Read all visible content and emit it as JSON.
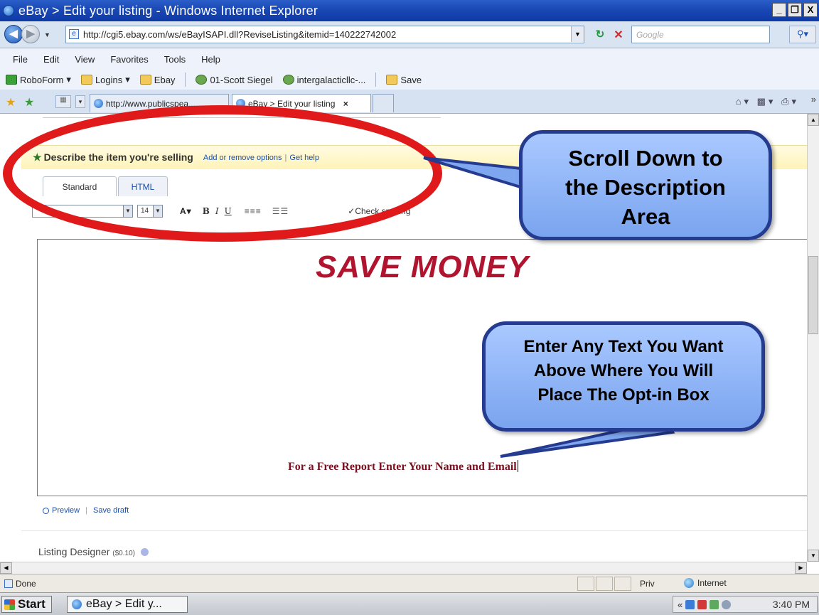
{
  "window": {
    "title": "eBay > Edit your listing - Windows Internet Explorer",
    "controls": [
      "_",
      "❐",
      "X"
    ]
  },
  "address_bar": {
    "url": "http://cgi5.ebay.com/ws/eBayISAPI.dll?ReviseListing&itemid=140222742002",
    "search_placeholder": "Google"
  },
  "menu": {
    "items": [
      "File",
      "Edit",
      "View",
      "Favorites",
      "Tools",
      "Help"
    ]
  },
  "links_bar": {
    "items": [
      "RoboForm",
      "Logins",
      "Ebay",
      "01-Scott Siegel",
      "intergalacticllc-...",
      "Save"
    ]
  },
  "browser_tabs": [
    {
      "label": "http://www.publicspea..."
    },
    {
      "label": "eBay > Edit your listing",
      "close": "×"
    }
  ],
  "page": {
    "section": {
      "title": "Describe the item you're selling",
      "required_marker": "★",
      "link_add_remove": "Add or remove options",
      "link_separator": "|",
      "link_help": "Get help"
    },
    "editor_tabs": [
      "Standard",
      "HTML"
    ],
    "toolbar": {
      "font_size": "14",
      "bold": "B",
      "italic": "I",
      "underline": "U",
      "check_spelling": "Check spelling"
    },
    "editor": {
      "headline": "SAVE MONEY",
      "cta_text": "For a Free Report Enter Your Name and Email"
    },
    "below_links": {
      "preview": "Preview",
      "separator": "|",
      "save_draft": "Save draft"
    },
    "listing_designer": {
      "label": "Listing Designer",
      "price": "($0.10)"
    }
  },
  "annotations": {
    "callout_scroll": [
      "Scroll Down to",
      "the Description",
      "Area"
    ],
    "callout_enter": [
      "Enter Any Text You Want",
      "Above Where You Will",
      "Place The Opt-in Box"
    ],
    "ring_color": "#e01a1a",
    "callout_color": "#8fb4f7"
  },
  "status_bar": {
    "status": "Done",
    "privacy": "Priv",
    "zone": "Internet"
  },
  "taskbar": {
    "start": "Start",
    "task": "eBay > Edit y...",
    "tray_prefix": "«",
    "clock": "3:40 PM"
  },
  "colors": {
    "headline": "#b0142f",
    "cta": "#7a1020",
    "link": "#1a4fa8",
    "title_bar": "#1846b3"
  }
}
